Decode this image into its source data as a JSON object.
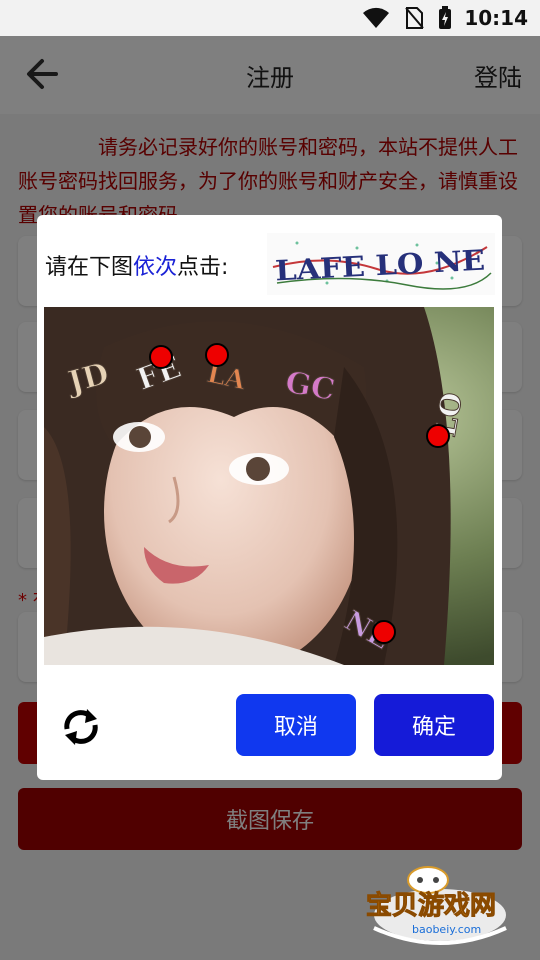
{
  "status": {
    "time": "10:14"
  },
  "appbar": {
    "title": "注册",
    "login_label": "登陆"
  },
  "notice": "请务必记录好你的账号和密码，本站不提供人工账号密码找回服务，为了你的账号和财产安全，请慎重设置您的账号和密码",
  "form": {
    "required_mark": "* 有",
    "save_label": "截图保存"
  },
  "captcha": {
    "prompt_prefix": "请在下图",
    "prompt_emphasis": "依次",
    "prompt_suffix": "点击:",
    "sequence_text": "LAFE LO NE",
    "scattered_labels": [
      "JD",
      "FE",
      "LA",
      "GC",
      "LO",
      "NE"
    ],
    "cancel_label": "取消",
    "confirm_label": "确定"
  },
  "watermark": {
    "title": "宝贝游戏网",
    "url": "baobeiy.com"
  },
  "colors": {
    "accent_blue": "#1038ef",
    "danger": "#c00000",
    "notice_red": "#b00000"
  }
}
